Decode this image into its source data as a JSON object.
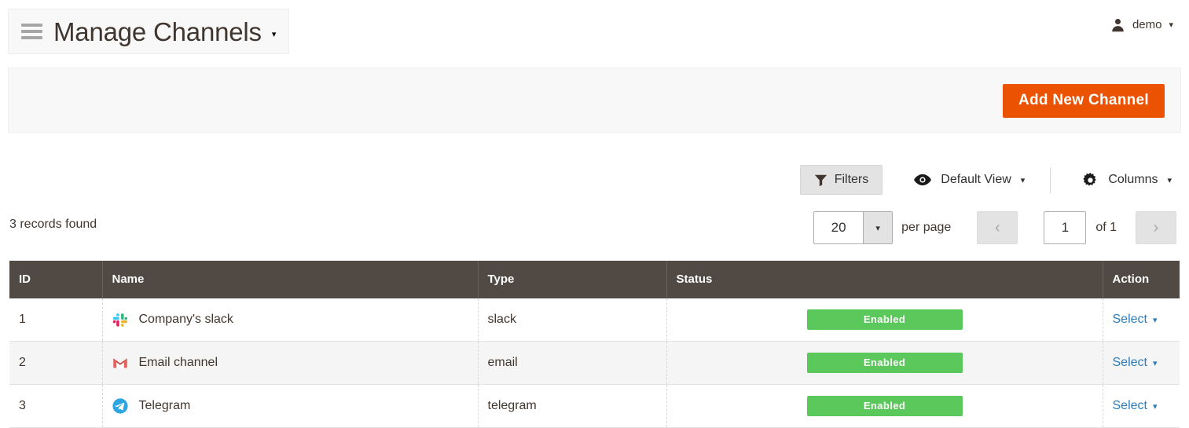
{
  "header": {
    "menu_icon": "hamburger-icon",
    "title": "Manage Channels",
    "title_caret": "▾",
    "user": {
      "icon": "user-icon",
      "name": "demo",
      "caret": "▾"
    }
  },
  "page_actions": {
    "add_button_label": "Add New Channel",
    "add_button_color": "#eb5202"
  },
  "grid_toolbar": {
    "filters_label": "Filters",
    "filters_icon": "funnel-icon",
    "view_label": "Default View",
    "view_icon": "eye-icon",
    "view_caret": "▾",
    "columns_label": "Columns",
    "columns_icon": "gear-icon",
    "columns_caret": "▾"
  },
  "grid_info": {
    "records_found": "3 records found",
    "per_page_value": "20",
    "per_page_label": "per page",
    "per_page_caret": "▾",
    "prev_icon": "‹",
    "page_value": "1",
    "of_label": "of 1",
    "next_icon": "›"
  },
  "table": {
    "columns": [
      "ID",
      "Name",
      "Type",
      "Status",
      "Action"
    ],
    "rows": [
      {
        "id": "1",
        "icon": "slack-icon",
        "name": "Company's slack",
        "type": "slack",
        "status": "Enabled",
        "status_color": "#5bc85b",
        "action": "Select",
        "action_caret": "▾"
      },
      {
        "id": "2",
        "icon": "gmail-icon",
        "name": "Email channel",
        "type": "email",
        "status": "Enabled",
        "status_color": "#5bc85b",
        "action": "Select",
        "action_caret": "▾"
      },
      {
        "id": "3",
        "icon": "telegram-icon",
        "name": "Telegram",
        "type": "telegram",
        "status": "Enabled",
        "status_color": "#5bc85b",
        "action": "Select",
        "action_caret": "▾"
      }
    ]
  }
}
